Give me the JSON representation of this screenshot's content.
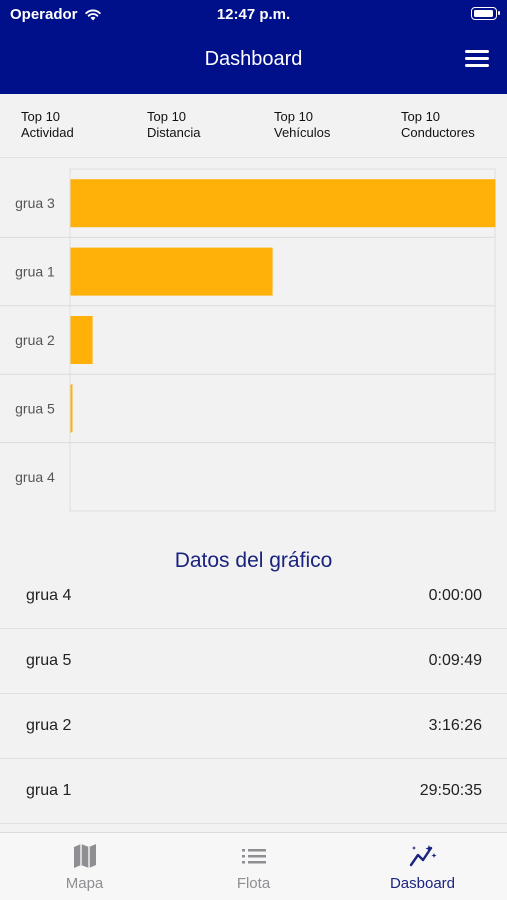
{
  "status": {
    "carrier": "Operador",
    "time": "12:47 p.m."
  },
  "nav": {
    "title": "Dashboard"
  },
  "tabs": [
    {
      "label": "Top 10\nActividad",
      "active": true
    },
    {
      "label": "Top 10\nDistancia",
      "active": false
    },
    {
      "label": "Top 10\nVehículos",
      "active": false
    },
    {
      "label": "Top 10\nConductores",
      "active": false
    }
  ],
  "colors": {
    "brand": "#000f8a",
    "bar": "#ffb10a",
    "accent": "#1a237e"
  },
  "chart_data": {
    "type": "bar",
    "orientation": "horizontal",
    "categories": [
      "grua 3",
      "grua 1",
      "grua 2",
      "grua 5",
      "grua 4"
    ],
    "values": [
      62.75,
      29.84,
      3.27,
      0.16,
      0
    ],
    "value_unit": "hours",
    "title": "",
    "xlabel": "",
    "ylabel": "",
    "grid": true
  },
  "data_section": {
    "title": "Datos del gráfico",
    "rows": [
      {
        "name": "grua 4",
        "value": "0:00:00"
      },
      {
        "name": "grua 5",
        "value": "0:09:49"
      },
      {
        "name": "grua 2",
        "value": "3:16:26"
      },
      {
        "name": "grua 1",
        "value": "29:50:35"
      }
    ]
  },
  "tab_bar": [
    {
      "label": "Mapa",
      "icon": "map-icon",
      "active": false
    },
    {
      "label": "Flota",
      "icon": "list-icon",
      "active": false
    },
    {
      "label": "Dasboard",
      "icon": "chart-icon",
      "active": true
    }
  ]
}
